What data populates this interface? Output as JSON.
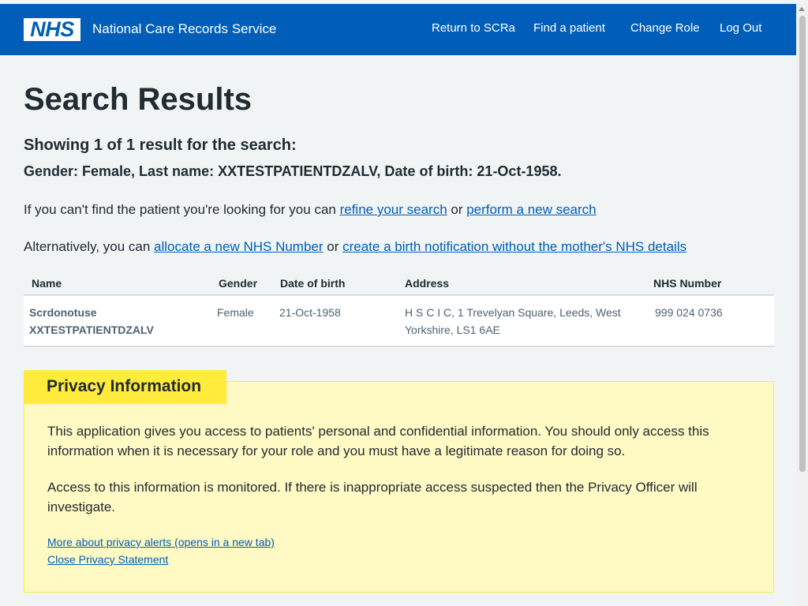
{
  "header": {
    "logo_text": "NHS",
    "service_name": "National Care Records Service",
    "nav": [
      "Return to SCRa",
      "Find a patient",
      "Change Role",
      "Log Out"
    ]
  },
  "main": {
    "title": "Search Results",
    "subtitle": "Showing 1 of 1 result for the search:",
    "criteria": "Gender: Female, Last name: XXTESTPATIENTDZALV, Date of birth: 21-Oct-1958.",
    "refine_prefix": "If you can't find the patient you're looking for you can ",
    "refine_link": "refine your search",
    "refine_or": " or ",
    "new_search_link": "perform a new search",
    "alt_prefix": "Alternatively, you can ",
    "allocate_link": "allocate a new NHS Number",
    "alt_or": " or ",
    "birth_link": "create a birth notification without the mother's NHS details"
  },
  "table": {
    "headers": [
      "Name",
      "Gender",
      "Date of birth",
      "Address",
      "NHS Number"
    ],
    "rows": [
      {
        "name_line1": "Scrdonotuse",
        "name_line2": "XXTESTPATIENTDZALV",
        "gender": "Female",
        "dob": "21-Oct-1958",
        "address_line1": "H S C I C, 1 Trevelyan Square, Leeds, West",
        "address_line2": "Yorkshire, LS1 6AE",
        "nhs_number": "999 024 0736"
      }
    ]
  },
  "privacy": {
    "heading": "Privacy Information",
    "para1_line1": "This application gives you access to patients' personal and confidential information. You should only access this",
    "para1_line2": "information when it is necessary for your role and you must have a legitimate reason for doing so.",
    "para2_line1": "Access to this information is monitored. If there is inappropriate access suspected then the Privacy Officer will",
    "para2_line2": "investigate.",
    "more_link": "More about privacy alerts (opens in a new tab)",
    "close_link": "Close Privacy Statement"
  },
  "colors": {
    "nhs_blue": "#005eb8",
    "page_bg": "#f0f4f5",
    "privacy_bg": "#fff9c4",
    "privacy_tab": "#ffeb3b"
  }
}
